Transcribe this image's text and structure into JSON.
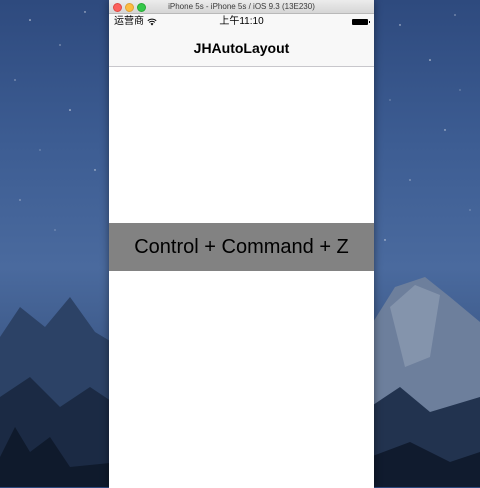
{
  "simulator": {
    "window_title": "iPhone 5s - iPhone 5s / iOS 9.3 (13E230)"
  },
  "statusbar": {
    "carrier": "运营商",
    "time": "上午11:10",
    "wifi_icon": "wifi-icon",
    "battery_icon": "battery-icon"
  },
  "navbar": {
    "title": "JHAutoLayout"
  },
  "content": {
    "banner_text": "Control + Command + Z",
    "banner_color": "#828282"
  },
  "desktop": {
    "wallpaper": "yosemite-night"
  }
}
